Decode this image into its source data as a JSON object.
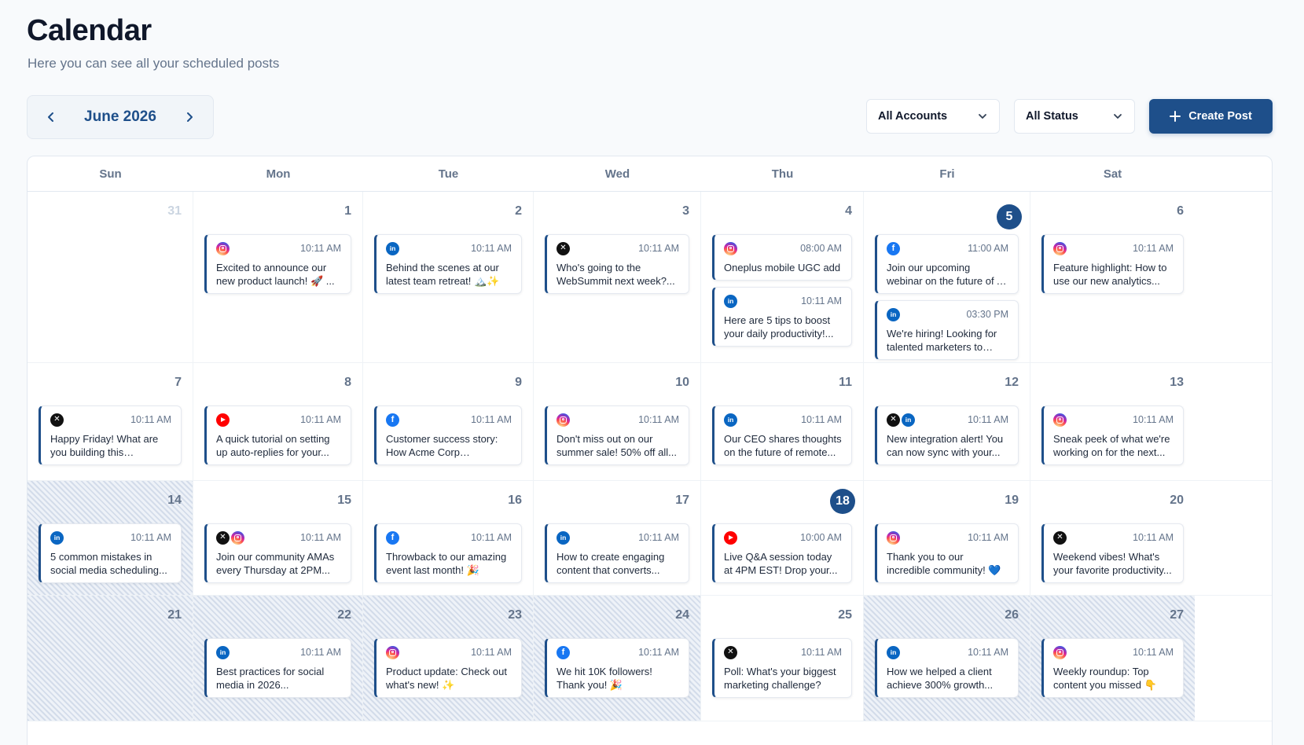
{
  "header": {
    "title": "Calendar",
    "subtitle": "Here you can see all your scheduled posts"
  },
  "month_nav": {
    "label": "June 2026",
    "prev_icon": "chevron-left-icon",
    "next_icon": "chevron-right-icon"
  },
  "filters": {
    "accounts_label": "All Accounts",
    "status_label": "All Status",
    "create_label": "Create Post"
  },
  "colors": {
    "primary": "#1e4f8a",
    "instagram": "#d6249f",
    "linkedin": "#0a66c2",
    "facebook": "#1877f2",
    "youtube": "#ff0000",
    "x": "#111111"
  },
  "weekdays": [
    "Sun",
    "Mon",
    "Tue",
    "Wed",
    "Thu",
    "Fri",
    "Sat"
  ],
  "weeks": [
    [
      {
        "day": "31",
        "muted": true,
        "posts": []
      },
      {
        "day": "1",
        "posts": [
          {
            "icons": [
              "instagram"
            ],
            "time": "10:11 AM",
            "text": "Excited to announce our new product launch! 🚀 ..."
          }
        ]
      },
      {
        "day": "2",
        "posts": [
          {
            "icons": [
              "linkedin"
            ],
            "time": "10:11 AM",
            "text": "Behind the scenes at our latest team retreat! 🏔️✨"
          }
        ]
      },
      {
        "day": "3",
        "posts": [
          {
            "icons": [
              "x"
            ],
            "time": "10:11 AM",
            "text": "Who's going to the WebSummit next week?..."
          }
        ]
      },
      {
        "day": "4",
        "posts": [
          {
            "icons": [
              "instagram"
            ],
            "time": "08:00 AM",
            "text": "Oneplus mobile UGC add"
          },
          {
            "icons": [
              "linkedin"
            ],
            "time": "10:11 AM",
            "text": "Here are 5 tips to boost your daily productivity!..."
          }
        ]
      },
      {
        "day": "5",
        "today": true,
        "posts": [
          {
            "icons": [
              "facebook"
            ],
            "time": "11:00 AM",
            "text": "Join our upcoming webinar on the future of AI in..."
          },
          {
            "icons": [
              "linkedin"
            ],
            "time": "03:30 PM",
            "text": "We're hiring! Looking for talented marketers to join..."
          }
        ]
      },
      {
        "day": "6",
        "posts": [
          {
            "icons": [
              "instagram"
            ],
            "time": "10:11 AM",
            "text": "Feature highlight: How to use our new analytics..."
          }
        ]
      }
    ],
    [
      {
        "day": "7",
        "posts": [
          {
            "icons": [
              "x"
            ],
            "time": "10:11 AM",
            "text": "Happy Friday! What are you building this weekend? 🛠️"
          }
        ]
      },
      {
        "day": "8",
        "posts": [
          {
            "icons": [
              "youtube"
            ],
            "time": "10:11 AM",
            "text": "A quick tutorial on setting up auto-replies for your..."
          }
        ]
      },
      {
        "day": "9",
        "posts": [
          {
            "icons": [
              "facebook"
            ],
            "time": "10:11 AM",
            "text": "Customer success story: How Acme Corp increased..."
          }
        ]
      },
      {
        "day": "10",
        "posts": [
          {
            "icons": [
              "instagram"
            ],
            "time": "10:11 AM",
            "text": "Don't miss out on our summer sale! 50% off all..."
          }
        ]
      },
      {
        "day": "11",
        "posts": [
          {
            "icons": [
              "linkedin"
            ],
            "time": "10:11 AM",
            "text": "Our CEO shares thoughts on the future of remote..."
          }
        ]
      },
      {
        "day": "12",
        "posts": [
          {
            "icons": [
              "x",
              "linkedin"
            ],
            "time": "10:11 AM",
            "text": "New integration alert! You can now sync with your..."
          }
        ]
      },
      {
        "day": "13",
        "posts": [
          {
            "icons": [
              "instagram"
            ],
            "time": "10:11 AM",
            "text": "Sneak peek of what we're working on for the next..."
          }
        ]
      }
    ],
    [
      {
        "day": "14",
        "hatched": true,
        "posts": [
          {
            "icons": [
              "linkedin"
            ],
            "time": "10:11 AM",
            "text": "5 common mistakes in social media scheduling..."
          }
        ]
      },
      {
        "day": "15",
        "posts": [
          {
            "icons": [
              "x",
              "instagram"
            ],
            "time": "10:11 AM",
            "text": "Join our community AMAs every Thursday at 2PM..."
          }
        ]
      },
      {
        "day": "16",
        "posts": [
          {
            "icons": [
              "facebook"
            ],
            "time": "10:11 AM",
            "text": "Throwback to our amazing event last month! 🎉"
          }
        ]
      },
      {
        "day": "17",
        "posts": [
          {
            "icons": [
              "linkedin"
            ],
            "time": "10:11 AM",
            "text": "How to create engaging content that converts..."
          }
        ]
      },
      {
        "day": "18",
        "today": true,
        "posts": [
          {
            "icons": [
              "youtube"
            ],
            "time": "10:00 AM",
            "text": "Live Q&A session today at 4PM EST! Drop your..."
          }
        ]
      },
      {
        "day": "19",
        "posts": [
          {
            "icons": [
              "instagram"
            ],
            "time": "10:11 AM",
            "text": "Thank you to our incredible community! 💙"
          }
        ]
      },
      {
        "day": "20",
        "posts": [
          {
            "icons": [
              "x"
            ],
            "time": "10:11 AM",
            "text": "Weekend vibes! What's your favorite productivity..."
          }
        ]
      }
    ],
    [
      {
        "day": "21",
        "hatched": true,
        "posts": []
      },
      {
        "day": "22",
        "hatched": true,
        "posts": [
          {
            "icons": [
              "linkedin"
            ],
            "time": "10:11 AM",
            "text": "Best practices for social media in 2026..."
          }
        ]
      },
      {
        "day": "23",
        "hatched": true,
        "posts": [
          {
            "icons": [
              "instagram"
            ],
            "time": "10:11 AM",
            "text": "Product update: Check out what's new! ✨"
          }
        ]
      },
      {
        "day": "24",
        "hatched": true,
        "posts": [
          {
            "icons": [
              "facebook"
            ],
            "time": "10:11 AM",
            "text": "We hit 10K followers! Thank you! 🎉"
          }
        ]
      },
      {
        "day": "25",
        "posts": [
          {
            "icons": [
              "x"
            ],
            "time": "10:11 AM",
            "text": "Poll: What's your biggest marketing challenge?"
          }
        ]
      },
      {
        "day": "26",
        "hatched": true,
        "posts": [
          {
            "icons": [
              "linkedin"
            ],
            "time": "10:11 AM",
            "text": "How we helped a client achieve 300% growth..."
          }
        ]
      },
      {
        "day": "27",
        "hatched": true,
        "posts": [
          {
            "icons": [
              "instagram"
            ],
            "time": "10:11 AM",
            "text": "Weekly roundup: Top content you missed 👇"
          }
        ]
      }
    ]
  ]
}
